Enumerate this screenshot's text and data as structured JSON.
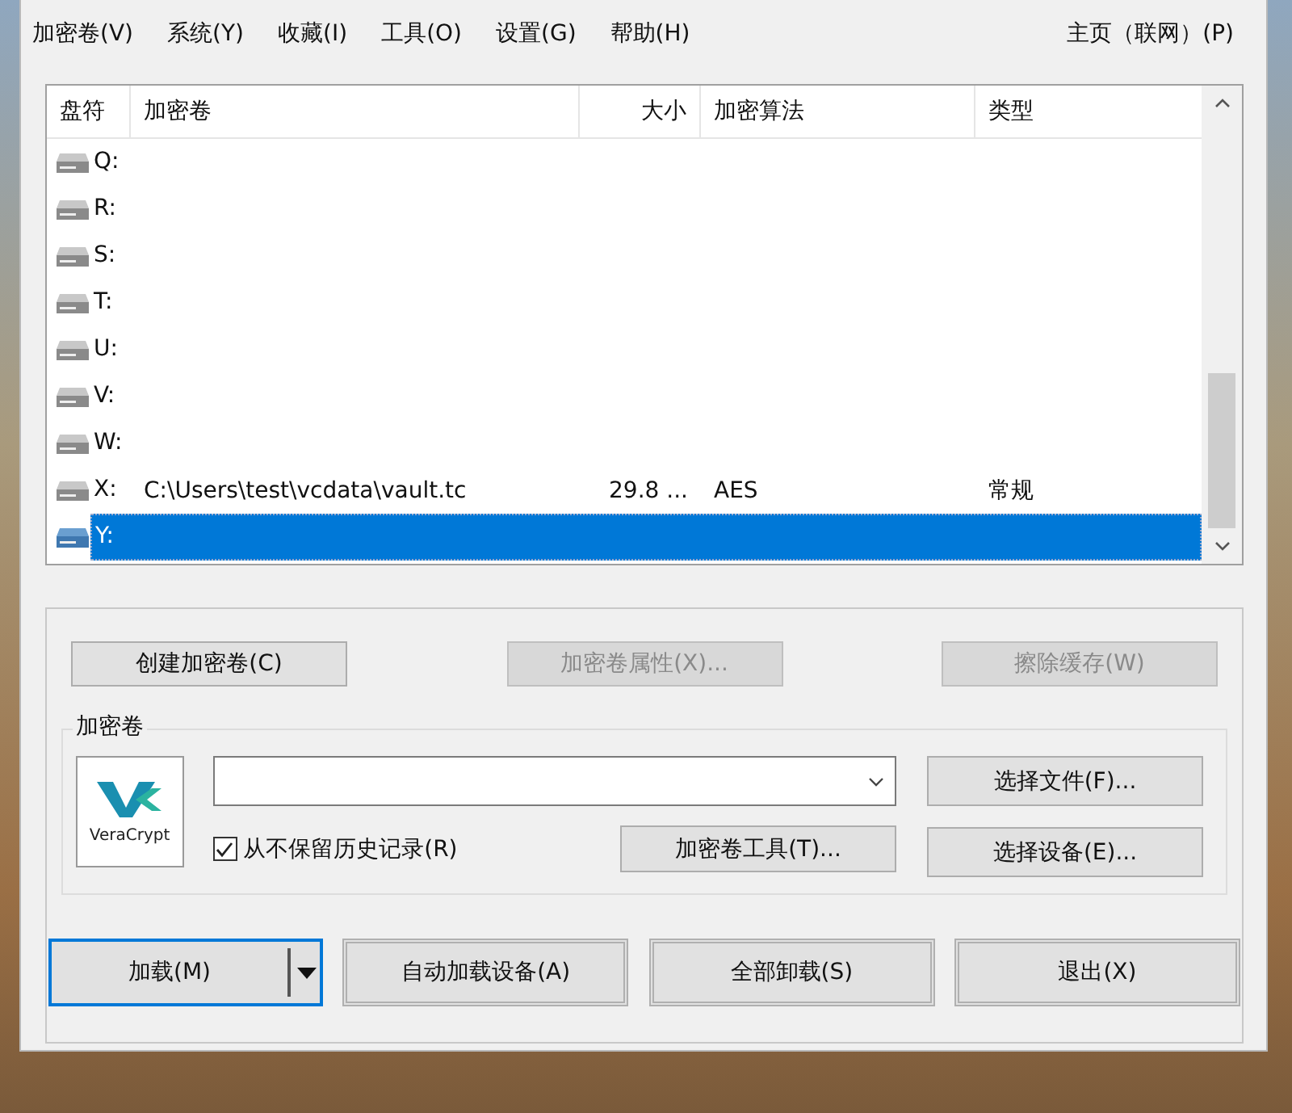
{
  "menu": {
    "items": [
      {
        "label": "加密卷(V)"
      },
      {
        "label": "系统(Y)"
      },
      {
        "label": "收藏(I)"
      },
      {
        "label": "工具(O)"
      },
      {
        "label": "设置(G)"
      },
      {
        "label": "帮助(H)"
      }
    ],
    "right_item": "主页（联网）(P)"
  },
  "table": {
    "columns": [
      "盘符",
      "加密卷",
      "大小",
      "加密算法",
      "类型"
    ],
    "rows": [
      {
        "drive": "Q:",
        "selected": false
      },
      {
        "drive": "R:",
        "selected": false
      },
      {
        "drive": "S:",
        "selected": false
      },
      {
        "drive": "T:",
        "selected": false
      },
      {
        "drive": "U:",
        "selected": false
      },
      {
        "drive": "V:",
        "selected": false
      },
      {
        "drive": "W:",
        "selected": false
      },
      {
        "drive": "X:",
        "volume": "C:\\Users\\test\\vcdata\\vault.tc",
        "size": "29.8 ...",
        "algorithm": "AES",
        "type": "常规",
        "selected": false
      },
      {
        "drive": "Y:",
        "selected": true
      }
    ]
  },
  "action_buttons": [
    {
      "label": "创建加密卷(C)",
      "disabled": false
    },
    {
      "label": "加密卷属性(X)...",
      "disabled": true
    },
    {
      "label": "擦除缓存(W)",
      "disabled": true
    }
  ],
  "volume_group": {
    "title": "加密卷",
    "logo_text": "VeraCrypt",
    "never_save_history": {
      "label": "从不保留历史记录(R)",
      "checked": true
    },
    "select_file": "选择文件(F)...",
    "volume_tools": "加密卷工具(T)...",
    "select_device": "选择设备(E)..."
  },
  "bottom_buttons": [
    {
      "label": "加载(M)",
      "kind": "split",
      "focused": true
    },
    {
      "label": "自动加载设备(A)",
      "kind": "plain",
      "focused": false
    },
    {
      "label": "全部卸载(S)",
      "kind": "plain",
      "focused": false
    },
    {
      "label": "退出(X)",
      "kind": "plain",
      "focused": false
    }
  ]
}
